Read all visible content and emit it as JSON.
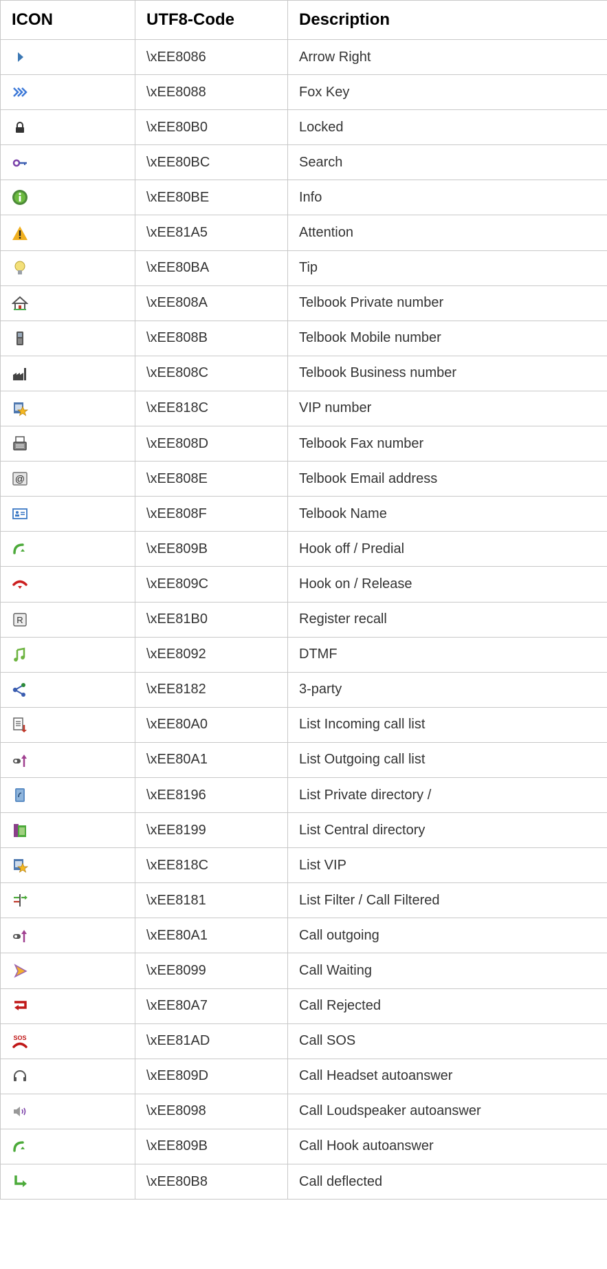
{
  "table": {
    "headers": [
      "ICON",
      "UTF8-Code",
      "Description"
    ],
    "rows": [
      {
        "icon": "arrow-right-icon",
        "code": "\\xEE8086",
        "description": "Arrow Right"
      },
      {
        "icon": "fox-key-icon",
        "code": "\\xEE8088",
        "description": "Fox Key"
      },
      {
        "icon": "lock-icon",
        "code": "\\xEE80B0",
        "description": "Locked"
      },
      {
        "icon": "search-key-icon",
        "code": "\\xEE80BC",
        "description": "Search"
      },
      {
        "icon": "info-icon",
        "code": "\\xEE80BE",
        "description": "Info"
      },
      {
        "icon": "warning-icon",
        "code": "\\xEE81A5",
        "description": "Attention"
      },
      {
        "icon": "lightbulb-icon",
        "code": "\\xEE80BA",
        "description": "Tip"
      },
      {
        "icon": "house-icon",
        "code": "\\xEE808A",
        "description": "Telbook Private number"
      },
      {
        "icon": "mobile-phone-icon",
        "code": "\\xEE808B",
        "description": "Telbook Mobile number"
      },
      {
        "icon": "factory-icon",
        "code": "\\xEE808C",
        "description": "Telbook Business number"
      },
      {
        "icon": "vip-card-icon",
        "code": "\\xEE818C",
        "description": "VIP number"
      },
      {
        "icon": "fax-icon",
        "code": "\\xEE808D",
        "description": "Telbook Fax number"
      },
      {
        "icon": "email-icon",
        "code": "\\xEE808E",
        "description": "Telbook Email address"
      },
      {
        "icon": "name-card-icon",
        "code": "\\xEE808F",
        "description": "Telbook Name"
      },
      {
        "icon": "hook-off-icon",
        "code": "\\xEE809B",
        "description": "Hook off / Predial"
      },
      {
        "icon": "hook-on-icon",
        "code": "\\xEE809C",
        "description": "Hook on / Release"
      },
      {
        "icon": "register-recall-icon",
        "code": "\\xEE81B0",
        "description": "Register recall"
      },
      {
        "icon": "music-note-icon",
        "code": "\\xEE8092",
        "description": "DTMF"
      },
      {
        "icon": "three-party-icon",
        "code": "\\xEE8182",
        "description": "3-party"
      },
      {
        "icon": "incoming-list-icon",
        "code": "\\xEE80A0",
        "description": "List Incoming call list"
      },
      {
        "icon": "outgoing-list-icon",
        "code": "\\xEE80A1",
        "description": "List Outgoing call list"
      },
      {
        "icon": "private-directory-icon",
        "code": "\\xEE8196",
        "description": "List Private directory /"
      },
      {
        "icon": "central-directory-icon",
        "code": "\\xEE8199",
        "description": "List Central directory"
      },
      {
        "icon": "vip-list-icon",
        "code": "\\xEE818C",
        "description": "List VIP"
      },
      {
        "icon": "filter-icon",
        "code": "\\xEE8181",
        "description": "List Filter / Call Filtered"
      },
      {
        "icon": "call-outgoing-icon",
        "code": "\\xEE80A1",
        "description": "Call outgoing"
      },
      {
        "icon": "call-waiting-icon",
        "code": "\\xEE8099",
        "description": "Call Waiting"
      },
      {
        "icon": "call-rejected-icon",
        "code": "\\xEE80A7",
        "description": "Call Rejected"
      },
      {
        "icon": "sos-icon",
        "code": "\\xEE81AD",
        "description": "Call SOS"
      },
      {
        "icon": "headset-icon",
        "code": "\\xEE809D",
        "description": "Call Headset autoanswer"
      },
      {
        "icon": "loudspeaker-icon",
        "code": "\\xEE8098",
        "description": "Call Loudspeaker autoanswer"
      },
      {
        "icon": "hook-autoanswer-icon",
        "code": "\\xEE809B",
        "description": "Call Hook autoanswer"
      },
      {
        "icon": "call-deflected-icon",
        "code": "\\xEE80B8",
        "description": "Call deflected"
      }
    ]
  }
}
